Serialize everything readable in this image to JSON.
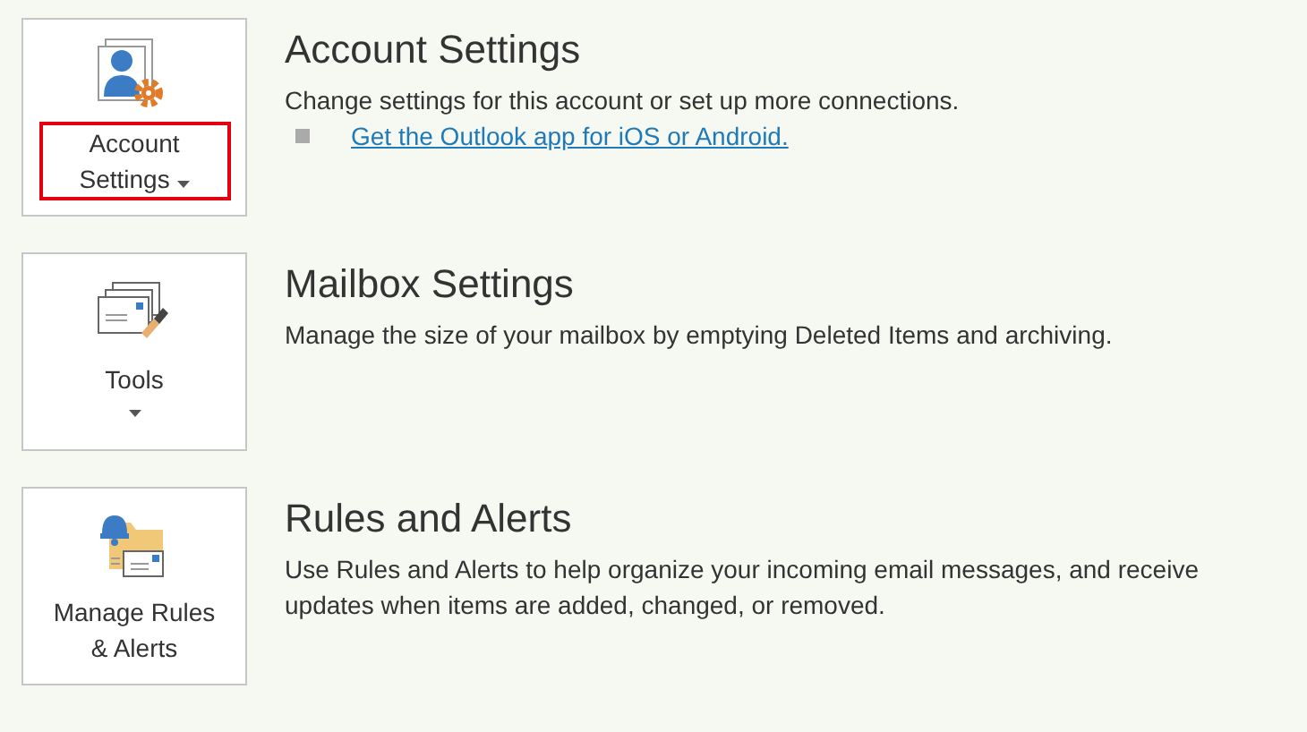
{
  "sections": [
    {
      "kind": "account",
      "button": {
        "label": "Account Settings",
        "dropdown": true,
        "highlighted": true
      },
      "title": "Account Settings",
      "description": "Change settings for this account or set up more connections.",
      "links": [
        "Get the Outlook app for iOS or Android."
      ]
    },
    {
      "kind": "tools",
      "button": {
        "label": "Tools",
        "dropdown": true,
        "highlighted": false
      },
      "title": "Mailbox Settings",
      "description": "Manage the size of your mailbox by emptying Deleted Items and archiving."
    },
    {
      "kind": "rules",
      "button": {
        "label": "Manage Rules & Alerts",
        "dropdown": false,
        "highlighted": false
      },
      "title": "Rules and Alerts",
      "description": "Use Rules and Alerts to help organize your incoming email messages, and receive updates when items are added, changed, or removed."
    }
  ]
}
